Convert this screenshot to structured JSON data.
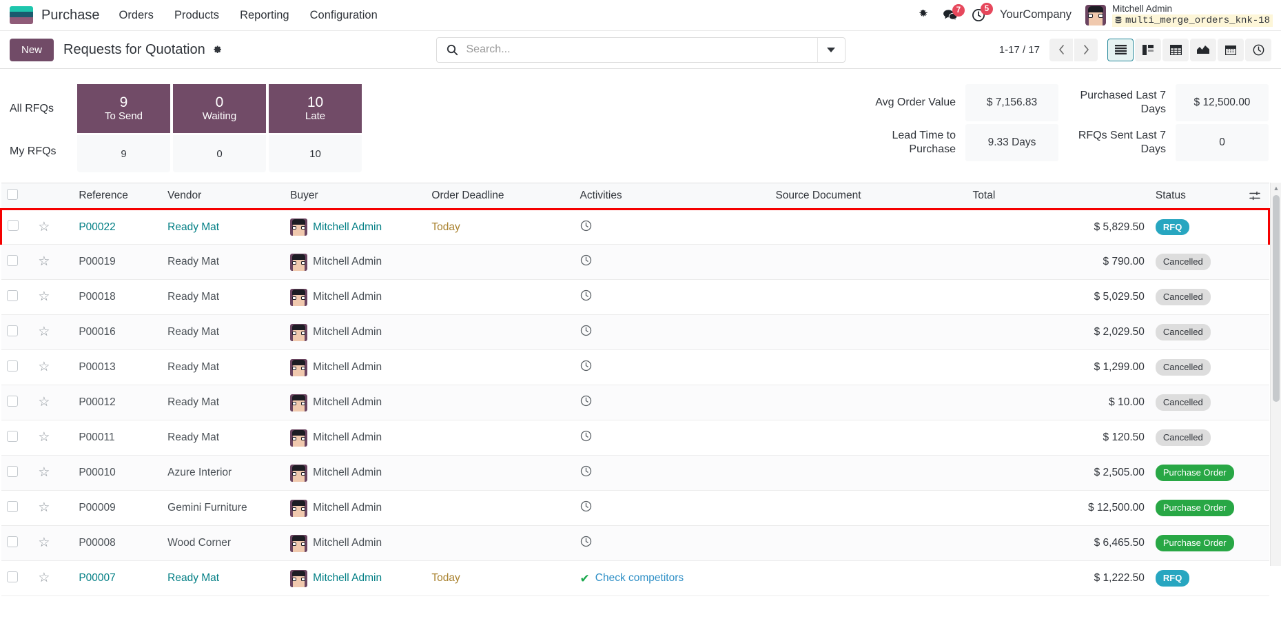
{
  "navbar": {
    "brand": "Purchase",
    "menu": [
      {
        "label": "Orders"
      },
      {
        "label": "Products"
      },
      {
        "label": "Reporting"
      },
      {
        "label": "Configuration"
      }
    ],
    "bug_icon": "bug-icon",
    "messages_icon": "messages-icon",
    "messages_count": "7",
    "activities_icon": "activities-clock-icon",
    "activities_count": "5",
    "company": "YourCompany",
    "user_name": "Mitchell Admin",
    "database": "multi_merge_orders_knk-18",
    "database_icon": "database-icon"
  },
  "control_panel": {
    "new_label": "New",
    "title": "Requests for Quotation",
    "settings_icon": "gear-icon",
    "search": {
      "placeholder": "Search...",
      "value": "",
      "icon": "search-icon",
      "dropdown_icon": "caret-down-icon"
    },
    "pager": {
      "range": "1-17 / 17",
      "prev_icon": "chevron-left-icon",
      "next_icon": "chevron-right-icon"
    },
    "views": [
      {
        "name": "list-view",
        "icon": "list-icon",
        "active": true
      },
      {
        "name": "kanban-view",
        "icon": "kanban-icon",
        "active": false
      },
      {
        "name": "pivot-view",
        "icon": "pivot-table-icon",
        "active": false
      },
      {
        "name": "graph-view",
        "icon": "area-chart-icon",
        "active": false
      },
      {
        "name": "calendar-view",
        "icon": "calendar-icon",
        "active": false
      },
      {
        "name": "activity-view",
        "icon": "clock-icon",
        "active": false
      }
    ]
  },
  "dashboard": {
    "row_labels": [
      "All RFQs",
      "My RFQs"
    ],
    "columns": [
      {
        "label": "To Send",
        "all": "9",
        "mine": "9"
      },
      {
        "label": "Waiting",
        "all": "0",
        "mine": "0"
      },
      {
        "label": "Late",
        "all": "10",
        "mine": "10"
      }
    ],
    "metrics": [
      {
        "label": "Avg Order Value",
        "value": "$ 7,156.83"
      },
      {
        "label": "Purchased Last 7 Days",
        "value": "$ 12,500.00"
      },
      {
        "label": "Lead Time to Purchase",
        "value": "9.33 Days"
      },
      {
        "label": "RFQs Sent Last 7 Days",
        "value": "0"
      }
    ]
  },
  "table": {
    "columns": [
      "Reference",
      "Vendor",
      "Buyer",
      "Order Deadline",
      "Activities",
      "Source Document",
      "Total",
      "Status"
    ],
    "options_icon": "column-options-icon",
    "rows": [
      {
        "reference": "P00022",
        "vendor": "Ready Mat",
        "buyer": "Mitchell Admin",
        "deadline": "Today",
        "activity": "",
        "activity_icon": "clock-icon",
        "source": "",
        "total": "$ 5,829.50",
        "status": "RFQ",
        "status_kind": "rfq",
        "link": true,
        "highlighted": true
      },
      {
        "reference": "P00019",
        "vendor": "Ready Mat",
        "buyer": "Mitchell Admin",
        "deadline": "",
        "activity": "",
        "activity_icon": "clock-icon",
        "source": "",
        "total": "$ 790.00",
        "status": "Cancelled",
        "status_kind": "cancelled",
        "link": false,
        "highlighted": false
      },
      {
        "reference": "P00018",
        "vendor": "Ready Mat",
        "buyer": "Mitchell Admin",
        "deadline": "",
        "activity": "",
        "activity_icon": "clock-icon",
        "source": "",
        "total": "$ 5,029.50",
        "status": "Cancelled",
        "status_kind": "cancelled",
        "link": false,
        "highlighted": false
      },
      {
        "reference": "P00016",
        "vendor": "Ready Mat",
        "buyer": "Mitchell Admin",
        "deadline": "",
        "activity": "",
        "activity_icon": "clock-icon",
        "source": "",
        "total": "$ 2,029.50",
        "status": "Cancelled",
        "status_kind": "cancelled",
        "link": false,
        "highlighted": false
      },
      {
        "reference": "P00013",
        "vendor": "Ready Mat",
        "buyer": "Mitchell Admin",
        "deadline": "",
        "activity": "",
        "activity_icon": "clock-icon",
        "source": "",
        "total": "$ 1,299.00",
        "status": "Cancelled",
        "status_kind": "cancelled",
        "link": false,
        "highlighted": false
      },
      {
        "reference": "P00012",
        "vendor": "Ready Mat",
        "buyer": "Mitchell Admin",
        "deadline": "",
        "activity": "",
        "activity_icon": "clock-icon",
        "source": "",
        "total": "$ 10.00",
        "status": "Cancelled",
        "status_kind": "cancelled",
        "link": false,
        "highlighted": false
      },
      {
        "reference": "P00011",
        "vendor": "Ready Mat",
        "buyer": "Mitchell Admin",
        "deadline": "",
        "activity": "",
        "activity_icon": "clock-icon",
        "source": "",
        "total": "$ 120.50",
        "status": "Cancelled",
        "status_kind": "cancelled",
        "link": false,
        "highlighted": false
      },
      {
        "reference": "P00010",
        "vendor": "Azure Interior",
        "buyer": "Mitchell Admin",
        "deadline": "",
        "activity": "",
        "activity_icon": "clock-icon",
        "source": "",
        "total": "$ 2,505.00",
        "status": "Purchase Order",
        "status_kind": "po",
        "link": false,
        "highlighted": false
      },
      {
        "reference": "P00009",
        "vendor": "Gemini Furniture",
        "buyer": "Mitchell Admin",
        "deadline": "",
        "activity": "",
        "activity_icon": "clock-icon",
        "source": "",
        "total": "$ 12,500.00",
        "status": "Purchase Order",
        "status_kind": "po",
        "link": false,
        "highlighted": false
      },
      {
        "reference": "P00008",
        "vendor": "Wood Corner",
        "buyer": "Mitchell Admin",
        "deadline": "",
        "activity": "",
        "activity_icon": "clock-icon",
        "source": "",
        "total": "$ 6,465.50",
        "status": "Purchase Order",
        "status_kind": "po",
        "link": false,
        "highlighted": false
      },
      {
        "reference": "P00007",
        "vendor": "Ready Mat",
        "buyer": "Mitchell Admin",
        "deadline": "Today",
        "activity": "Check competitors",
        "activity_icon": "check-icon",
        "source": "",
        "total": "$ 1,222.50",
        "status": "RFQ",
        "status_kind": "rfq",
        "link": true,
        "highlighted": false
      }
    ]
  },
  "colors": {
    "brand_purple": "#714b67",
    "accent_teal": "#017e84",
    "badge_rfq": "#27a6c0",
    "badge_po": "#28a745",
    "badge_cancelled": "#dddddd",
    "highlight_red": "#f50000",
    "notification_red": "#e6485c"
  }
}
